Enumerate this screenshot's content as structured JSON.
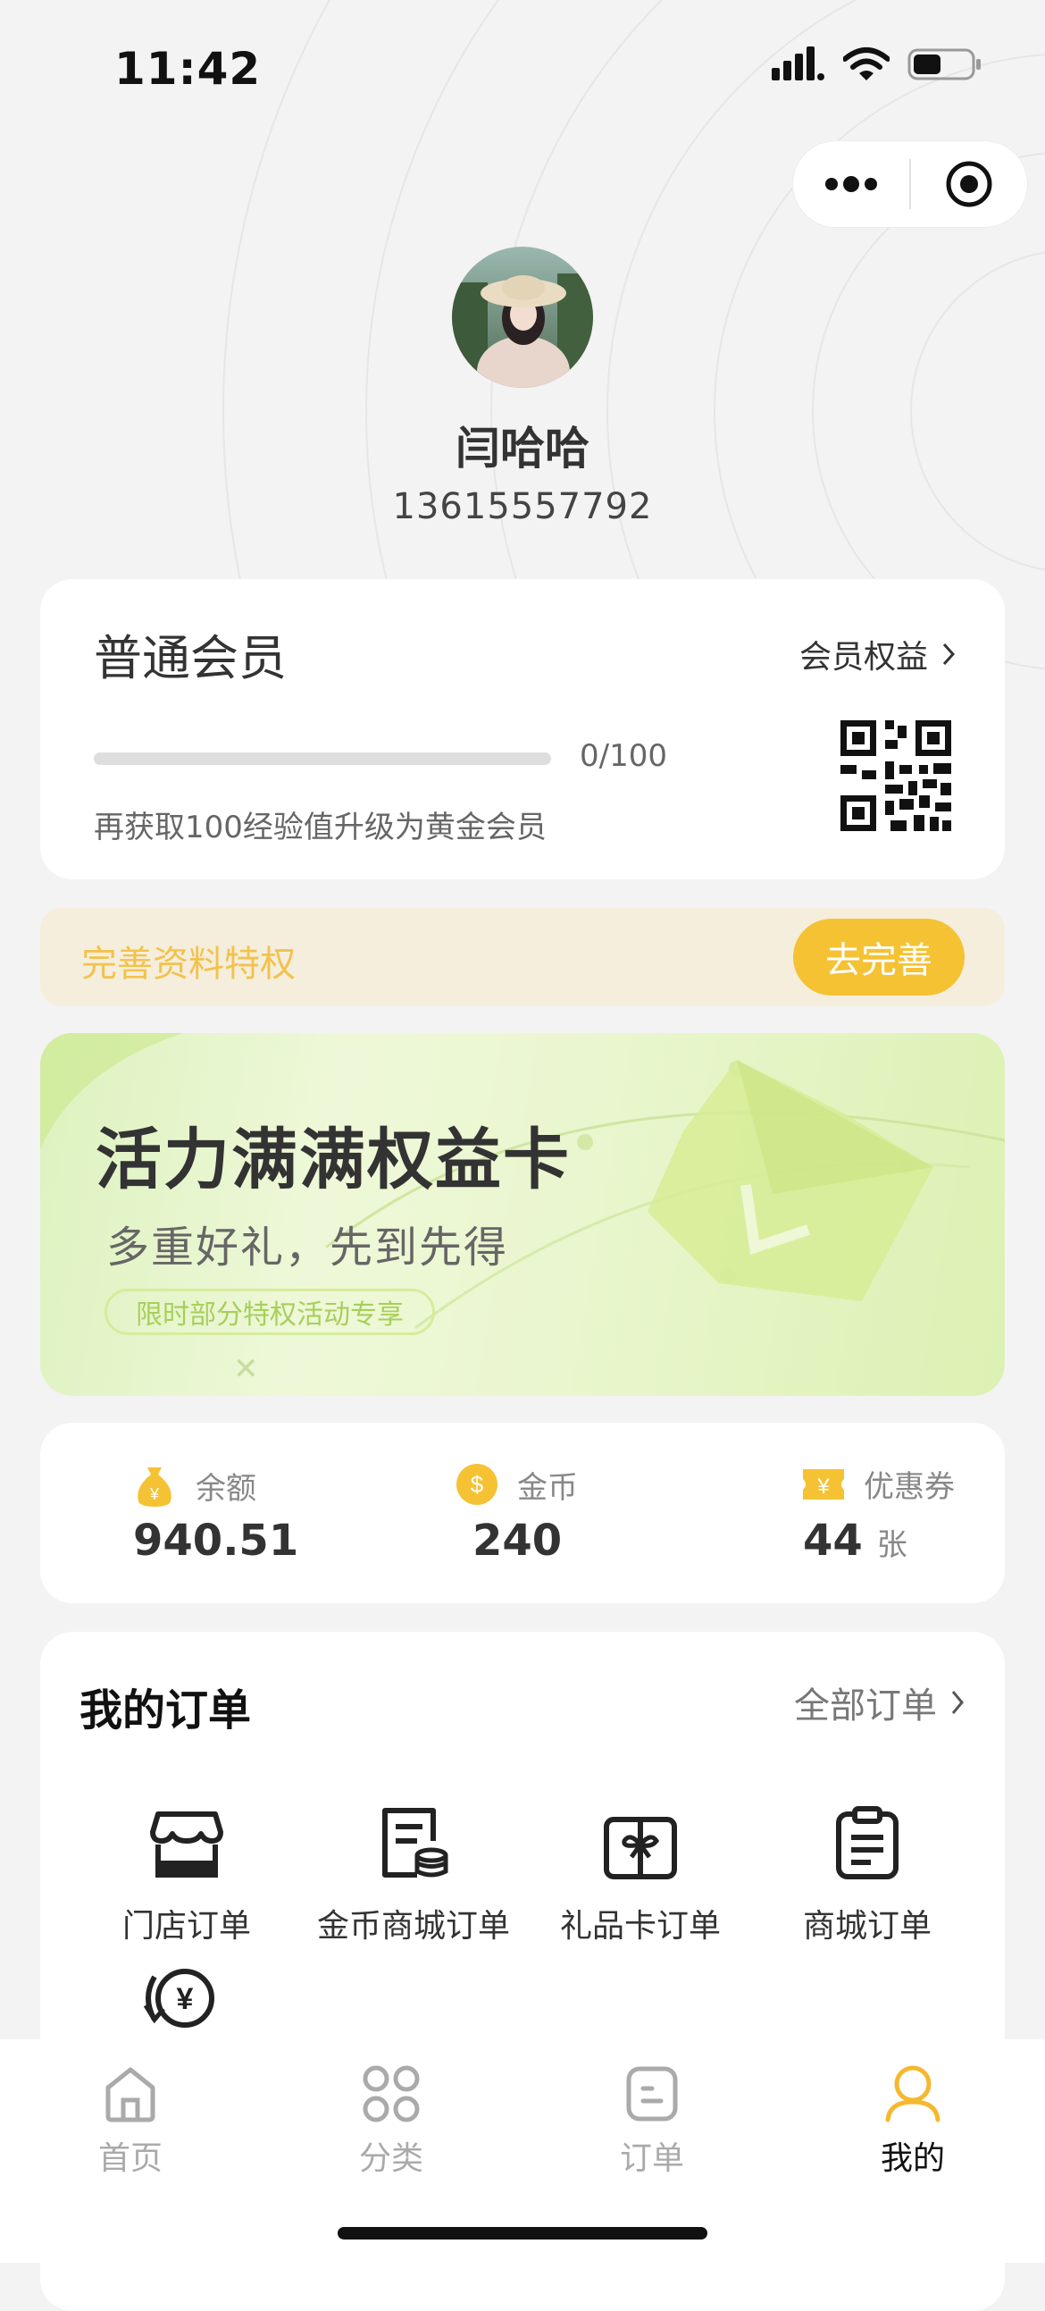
{
  "status_bar": {
    "time": "11:42"
  },
  "profile": {
    "name": "闫哈哈",
    "phone": "13615557792"
  },
  "member": {
    "level": "普通会员",
    "benefits_link": "会员权益",
    "progress_text": "0/100",
    "progress_fraction": 0,
    "upgrade_hint": "再获取100经验值升级为黄金会员"
  },
  "privilege": {
    "text": "完善资料特权",
    "button": "去完善"
  },
  "banner": {
    "title": "活力满满权益卡",
    "subtitle": "多重好礼，先到先得",
    "tag": "限时部分特权活动专享"
  },
  "assets": {
    "balance": {
      "label": "余额",
      "value": "940.51"
    },
    "coins": {
      "label": "金币",
      "value": "240"
    },
    "coupons": {
      "label": "优惠券",
      "value": "44",
      "unit": "张"
    }
  },
  "orders": {
    "title": "我的订单",
    "all_link": "全部订单",
    "items": [
      {
        "label": "门店订单",
        "icon": "store-icon"
      },
      {
        "label": "金币商城订单",
        "icon": "coin-mall-icon"
      },
      {
        "label": "礼品卡订单",
        "icon": "gift-card-icon"
      },
      {
        "label": "商城订单",
        "icon": "clipboard-icon"
      }
    ]
  },
  "tabs": [
    {
      "label": "首页",
      "icon": "home-icon"
    },
    {
      "label": "分类",
      "icon": "category-icon"
    },
    {
      "label": "订单",
      "icon": "order-icon"
    },
    {
      "label": "我的",
      "icon": "profile-icon",
      "active": true
    }
  ],
  "colors": {
    "accent": "#f5c234",
    "privilege_bg": "#f5eedc",
    "banner_green": "#dcf1b3"
  }
}
